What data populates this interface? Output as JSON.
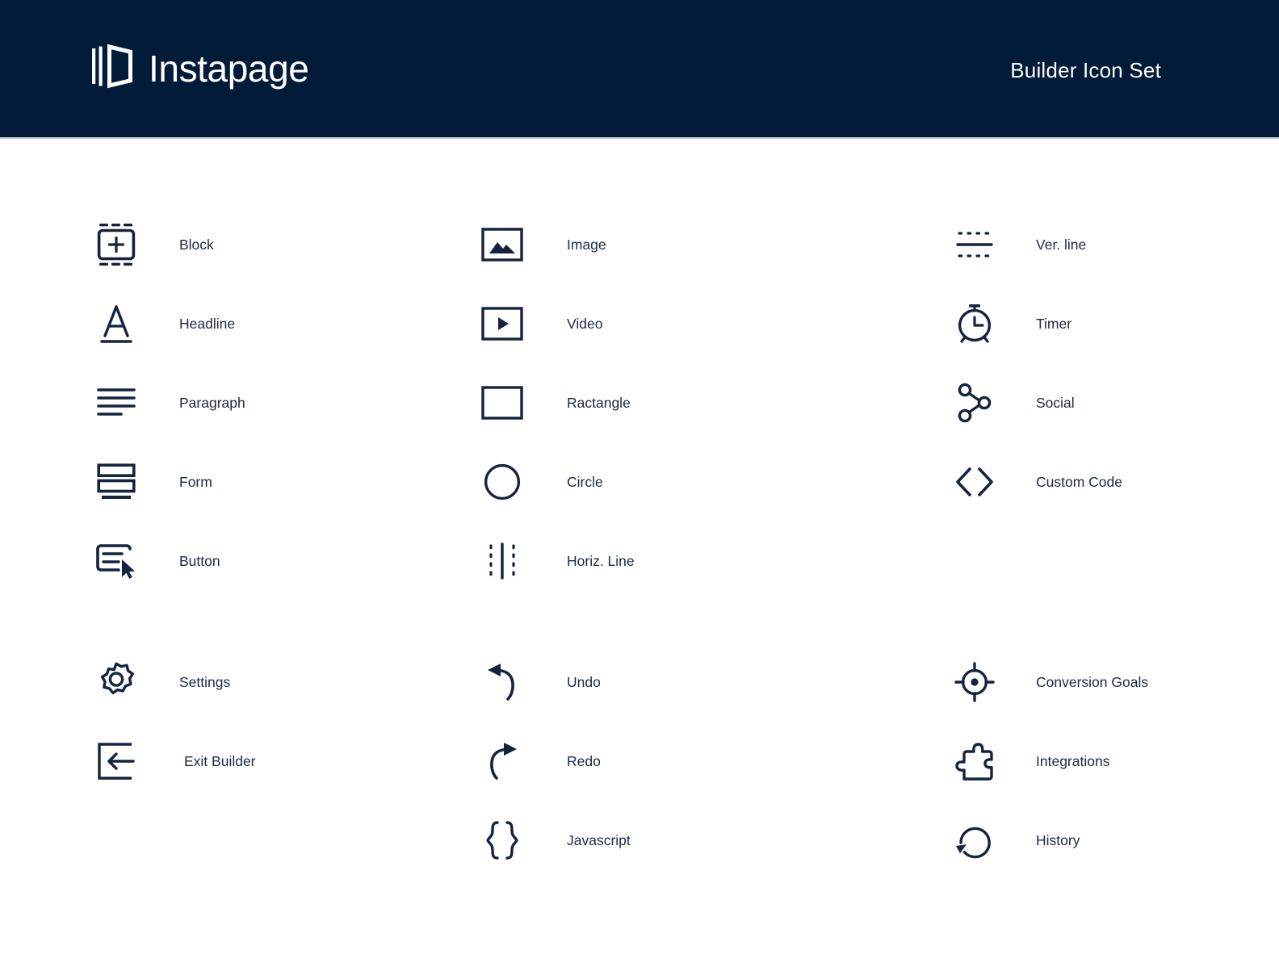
{
  "header": {
    "brand_name": "Instapage",
    "brand_logo_icon": "instapage-door-logo-icon",
    "title": "Builder Icon Set",
    "background_color": "#021B38",
    "text_color": "#FFFFFF"
  },
  "theme": {
    "icon_color": "#14233F",
    "label_color": "#1B2A44",
    "page_background": "#FFFFFF"
  },
  "groups": [
    {
      "name": "elements",
      "columns": [
        {
          "name": "column-1",
          "items": [
            {
              "label": "Block",
              "icon": "block-icon"
            },
            {
              "label": "Headline",
              "icon": "headline-icon"
            },
            {
              "label": "Paragraph",
              "icon": "paragraph-icon"
            },
            {
              "label": "Form",
              "icon": "form-icon"
            },
            {
              "label": "Button",
              "icon": "button-icon"
            }
          ]
        },
        {
          "name": "column-2",
          "items": [
            {
              "label": "Image",
              "icon": "image-icon"
            },
            {
              "label": "Video",
              "icon": "video-icon"
            },
            {
              "label": "Ractangle",
              "icon": "rectangle-icon"
            },
            {
              "label": "Circle",
              "icon": "circle-icon"
            },
            {
              "label": "Horiz. Line",
              "icon": "horizontal-line-icon"
            }
          ]
        },
        {
          "name": "column-3",
          "items": [
            {
              "label": "Ver. line",
              "icon": "vertical-line-icon"
            },
            {
              "label": "Timer",
              "icon": "timer-icon"
            },
            {
              "label": "Social",
              "icon": "social-share-icon"
            },
            {
              "label": "Custom Code",
              "icon": "custom-code-icon"
            }
          ]
        }
      ]
    },
    {
      "name": "actions",
      "columns": [
        {
          "name": "column-1",
          "items": [
            {
              "label": "Settings",
              "icon": "gear-icon"
            },
            {
              "label": "Exit Builder",
              "icon": "exit-builder-icon"
            }
          ]
        },
        {
          "name": "column-2",
          "items": [
            {
              "label": "Undo",
              "icon": "undo-arrow-icon"
            },
            {
              "label": "Redo",
              "icon": "redo-arrow-icon"
            },
            {
              "label": "Javascript",
              "icon": "curly-braces-icon"
            }
          ]
        },
        {
          "name": "column-3",
          "items": [
            {
              "label": "Conversion Goals",
              "icon": "target-icon"
            },
            {
              "label": "Integrations",
              "icon": "puzzle-piece-icon"
            },
            {
              "label": "History",
              "icon": "history-clock-arrow-icon"
            }
          ]
        }
      ]
    }
  ]
}
